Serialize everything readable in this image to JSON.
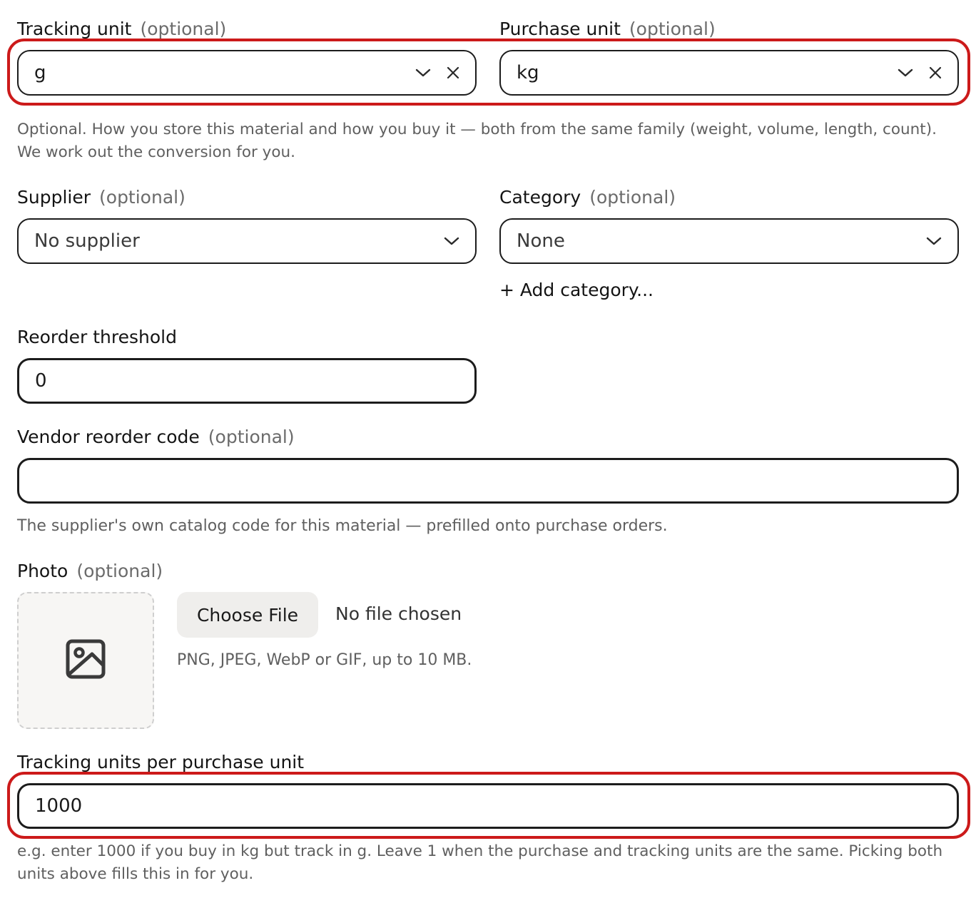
{
  "tracking_unit": {
    "label": "Tracking unit",
    "optional": "(optional)",
    "value": "g"
  },
  "purchase_unit": {
    "label": "Purchase unit",
    "optional": "(optional)",
    "value": "kg"
  },
  "units_help": {
    "line1": "Optional. How you store this material and how you buy it — both from the same family (weight, volume, length, count).",
    "line2": "We work out the conversion for you."
  },
  "supplier": {
    "label": "Supplier",
    "optional": "(optional)",
    "value": "No supplier"
  },
  "category": {
    "label": "Category",
    "optional": "(optional)",
    "value": "None",
    "add_label": "+ Add category..."
  },
  "reorder_threshold": {
    "label": "Reorder threshold",
    "value": "0"
  },
  "vendor_code": {
    "label": "Vendor reorder code",
    "optional": "(optional)",
    "value": "",
    "help": "The supplier's own catalog code for this material — prefilled onto purchase orders."
  },
  "photo": {
    "label": "Photo",
    "optional": "(optional)",
    "choose_label": "Choose File",
    "no_file": "No file chosen",
    "help": "PNG, JPEG, WebP or GIF, up to 10 MB."
  },
  "conversion": {
    "label": "Tracking units per purchase unit",
    "value": "1000",
    "help_line1": "e.g. enter 1000 if you buy in kg but track in g. Leave 1 when the purchase and tracking units are the same. Picking both",
    "help_line2": "units above fills this in for you."
  },
  "colors": {
    "highlight": "#cc1a1a",
    "border": "#1c1c1c",
    "muted_text": "#5f5f5f"
  }
}
